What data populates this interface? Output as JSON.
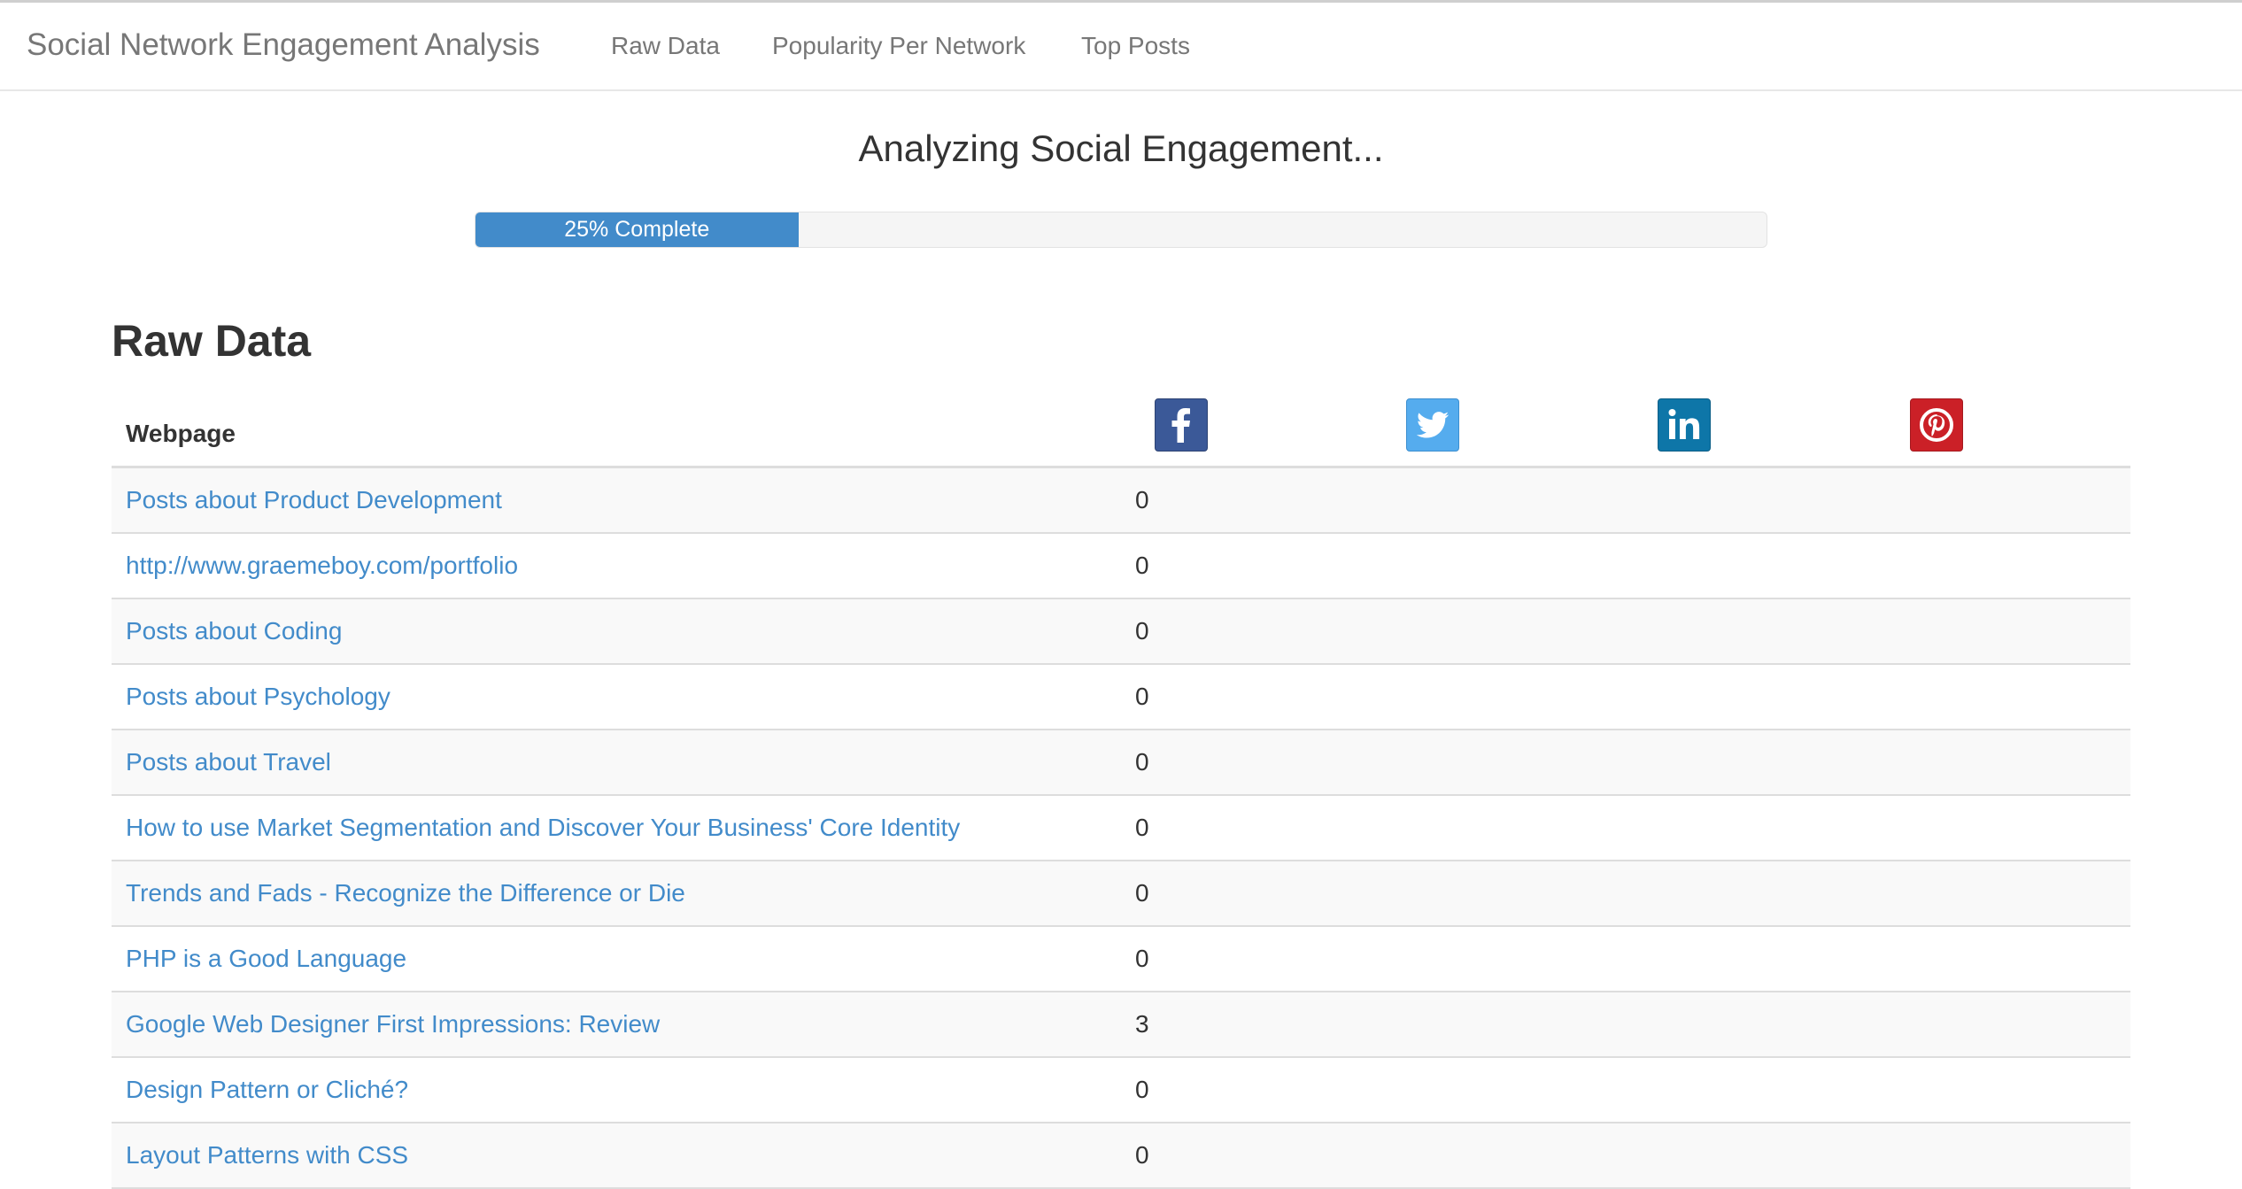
{
  "navbar": {
    "brand": "Social Network Engagement Analysis",
    "links": [
      "Raw Data",
      "Popularity Per Network",
      "Top Posts"
    ]
  },
  "progress": {
    "title": "Analyzing Social Engagement...",
    "percent": 25,
    "label": "25% Complete"
  },
  "raw_data": {
    "title": "Raw Data",
    "columns": {
      "webpage": "Webpage",
      "networks": [
        {
          "name": "facebook",
          "icon": "facebook-icon",
          "color": "#3b5998"
        },
        {
          "name": "twitter",
          "icon": "twitter-icon",
          "color": "#55acee"
        },
        {
          "name": "linkedin",
          "icon": "linkedin-icon",
          "color": "#0e76a8"
        },
        {
          "name": "pinterest",
          "icon": "pinterest-icon",
          "color": "#cb2027"
        }
      ]
    },
    "rows": [
      {
        "title": "Posts about Product Development",
        "facebook": "0"
      },
      {
        "title": "http://www.graemeboy.com/portfolio",
        "facebook": "0"
      },
      {
        "title": "Posts about Coding",
        "facebook": "0"
      },
      {
        "title": "Posts about Psychology",
        "facebook": "0"
      },
      {
        "title": "Posts about Travel",
        "facebook": "0"
      },
      {
        "title": "How to use Market Segmentation and Discover Your Business' Core Identity",
        "facebook": "0"
      },
      {
        "title": "Trends and Fads - Recognize the Difference or Die",
        "facebook": "0"
      },
      {
        "title": "PHP is a Good Language",
        "facebook": "0"
      },
      {
        "title": "Google Web Designer First Impressions: Review",
        "facebook": "3"
      },
      {
        "title": "Design Pattern or Cliché?",
        "facebook": "0"
      },
      {
        "title": "Layout Patterns with CSS",
        "facebook": "0"
      }
    ]
  },
  "colors": {
    "link": "#428bca",
    "progress_bar": "#428bca",
    "nav_text": "#777777"
  }
}
